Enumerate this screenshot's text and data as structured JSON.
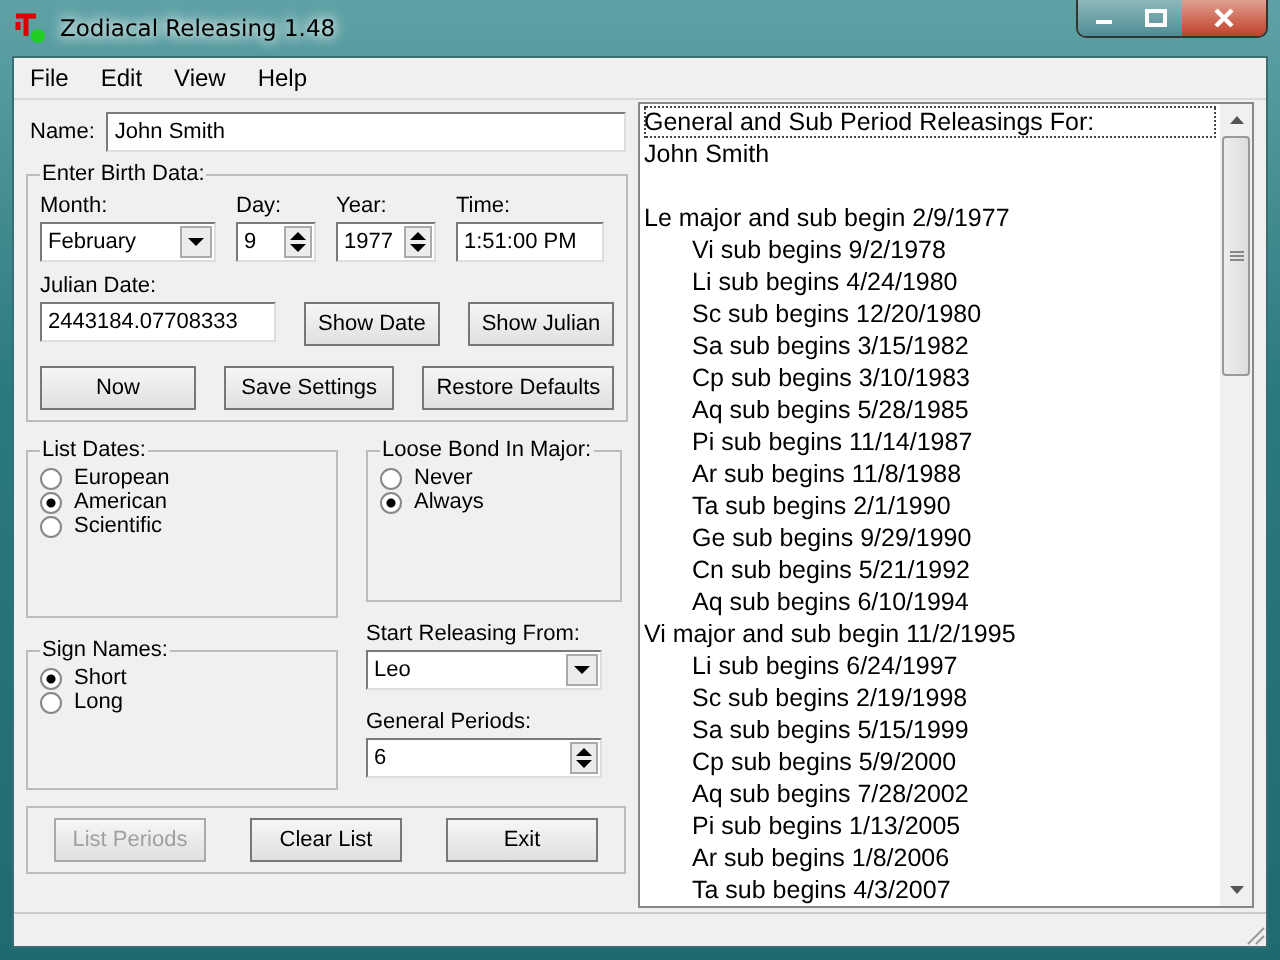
{
  "window": {
    "title": "Zodiacal Releasing 1.48"
  },
  "menu": [
    "File",
    "Edit",
    "View",
    "Help"
  ],
  "name_field": {
    "label": "Name:",
    "value": "John Smith"
  },
  "birth_data": {
    "label": "Enter Birth Data:",
    "month": {
      "label": "Month:",
      "value": "February"
    },
    "day": {
      "label": "Day:",
      "value": "9"
    },
    "year": {
      "label": "Year:",
      "value": "1977"
    },
    "time": {
      "label": "Time:",
      "value": "1:51:00 PM"
    },
    "julian": {
      "label": "Julian Date:",
      "value": "2443184.07708333"
    },
    "buttons": [
      {
        "label": "Show Date"
      },
      {
        "label": "Show Julian"
      }
    ],
    "bottom_buttons": [
      {
        "label": "Now"
      },
      {
        "label": "Save Settings"
      },
      {
        "label": "Restore Defaults"
      }
    ]
  },
  "list_dates": {
    "label": "List Dates:",
    "options": [
      {
        "label": "European",
        "selected": false
      },
      {
        "label": "American",
        "selected": true
      },
      {
        "label": "Scientific",
        "selected": false
      }
    ]
  },
  "loose_bond": {
    "label": "Loose Bond In Major:",
    "options": [
      {
        "label": "Never",
        "selected": false
      },
      {
        "label": "Always",
        "selected": true
      }
    ]
  },
  "sign_names": {
    "label": "Sign Names:",
    "options": [
      {
        "label": "Short",
        "selected": true
      },
      {
        "label": "Long",
        "selected": false
      }
    ]
  },
  "start_releasing": {
    "label": "Start Releasing From:",
    "value": "Leo"
  },
  "general_periods": {
    "label": "General Periods:",
    "value": "6"
  },
  "action_buttons": [
    {
      "label": "List Periods",
      "disabled": true
    },
    {
      "label": "Clear List",
      "disabled": false
    },
    {
      "label": "Exit",
      "disabled": false
    }
  ],
  "results": {
    "heading": "General and Sub Period Releasings For:",
    "name": "John Smith",
    "periods": [
      {
        "text": "Le major and sub begin 2/9/1977",
        "children": [
          {
            "text": "Vi sub begins 9/2/1978"
          },
          {
            "text": "Li sub begins 4/24/1980"
          },
          {
            "text": "Sc sub begins 12/20/1980"
          },
          {
            "text": "Sa sub begins 3/15/1982"
          },
          {
            "text": "Cp sub begins 3/10/1983"
          },
          {
            "text": "Aq sub begins 5/28/1985"
          },
          {
            "text": "Pi sub begins 11/14/1987"
          },
          {
            "text": "Ar sub begins 11/8/1988"
          },
          {
            "text": "Ta sub begins 2/1/1990"
          },
          {
            "text": "Ge sub begins 9/29/1990"
          },
          {
            "text": "Cn sub begins 5/21/1992"
          },
          {
            "text": "Aq sub begins 6/10/1994"
          }
        ]
      },
      {
        "text": "Vi major and sub begin 11/2/1995",
        "children": [
          {
            "text": "Li sub begins 6/24/1997"
          },
          {
            "text": "Sc sub begins 2/19/1998"
          },
          {
            "text": "Sa sub begins 5/15/1999"
          },
          {
            "text": "Cp sub begins 5/9/2000"
          },
          {
            "text": "Aq sub begins 7/28/2002"
          },
          {
            "text": "Pi sub begins 1/13/2005"
          },
          {
            "text": "Ar sub begins 1/8/2006"
          },
          {
            "text": "Ta sub begins 4/3/2007"
          }
        ]
      }
    ]
  }
}
